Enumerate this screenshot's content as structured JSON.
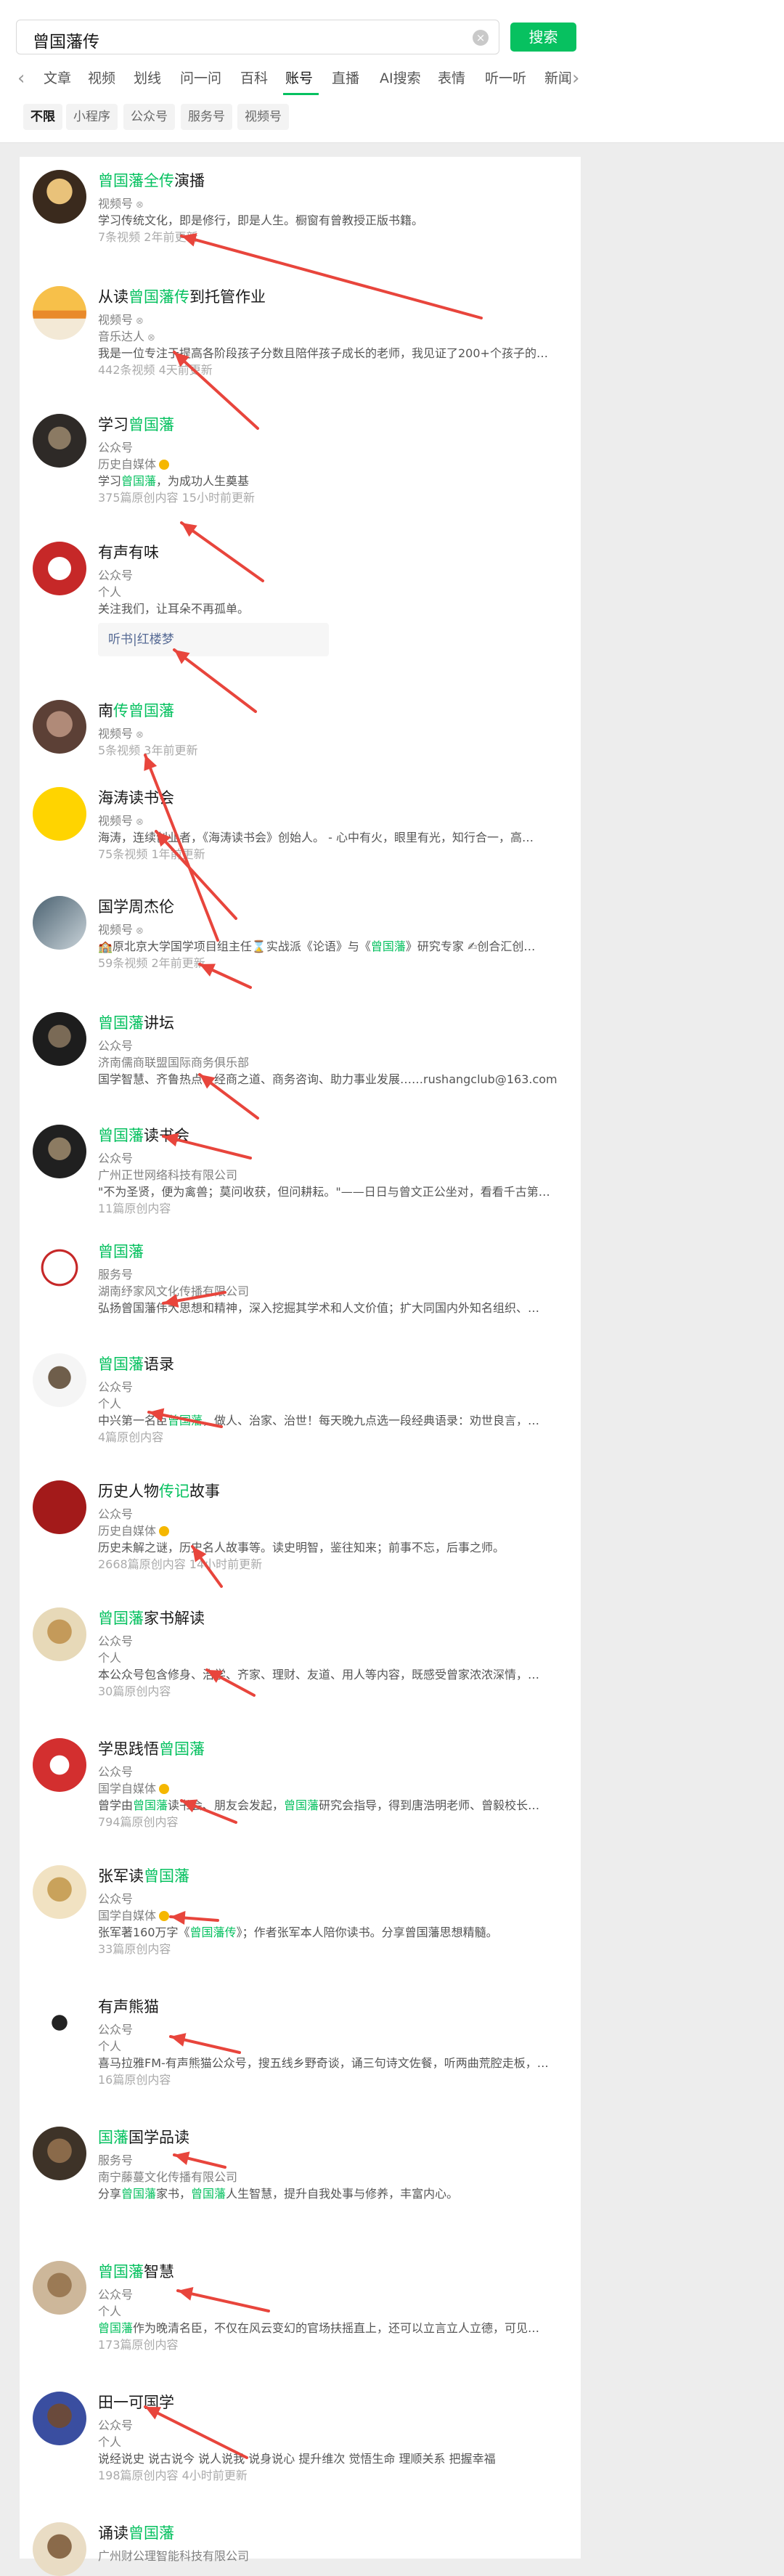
{
  "search": {
    "query": "曾国藩传",
    "clear_icon": "×",
    "button": "搜索"
  },
  "tabs": {
    "left_arrow": "‹",
    "right_arrow": "›",
    "items": [
      "文章",
      "视频",
      "划线",
      "问一问",
      "百科",
      "账号",
      "直播",
      "AI搜索",
      "表情",
      "听一听",
      "新闻"
    ],
    "active": "账号"
  },
  "subtabs": {
    "items": [
      "不限",
      "小程序",
      "公众号",
      "服务号",
      "视频号"
    ],
    "active": "不限"
  },
  "colors": {
    "brand_green": "#07c160",
    "annotation_red": "#e8453c"
  },
  "accounts": [
    {
      "name": [
        [
          "曾国藩全传",
          1
        ],
        [
          "演播",
          0
        ]
      ],
      "lines": [
        {
          "t": "视频号",
          "k": "type",
          "badge": "channel"
        },
        {
          "t": "学习传统文化，即是修行，即是人生。橱窗有曾教授正版书籍。",
          "k": "desc"
        },
        {
          "t": "7条视频  2年前更新",
          "k": "meta"
        }
      ]
    },
    {
      "name": [
        [
          "从读",
          0
        ],
        [
          "曾国藩传",
          1
        ],
        [
          "到托管作业",
          0
        ]
      ],
      "lines": [
        {
          "t": "视频号",
          "k": "type",
          "badge": "channel"
        },
        {
          "t": "音乐达人",
          "k": "type",
          "badge": "channel"
        },
        {
          "t": "我是一位专注于提高各阶段孩子分数且陪伴孩子成长的老师，我见证了200+个孩子的…",
          "k": "desc"
        },
        {
          "t": "442条视频  4天前更新",
          "k": "meta"
        }
      ]
    },
    {
      "name": [
        [
          "学习",
          0
        ],
        [
          "曾国藩",
          1
        ]
      ],
      "lines": [
        {
          "t": "公众号",
          "k": "type"
        },
        {
          "t": "历史自媒体",
          "k": "type",
          "badge": "verified"
        },
        {
          "rich": [
            [
              "学习",
              0
            ],
            [
              "曾国藩",
              1
            ],
            [
              "，为成功人生奠基",
              0
            ]
          ],
          "k": "desc"
        },
        {
          "t": "375篇原创内容  15小时前更新",
          "k": "meta"
        }
      ]
    },
    {
      "name": [
        [
          "有声有味",
          0
        ]
      ],
      "lines": [
        {
          "t": "公众号",
          "k": "type"
        },
        {
          "t": "个人",
          "k": "type"
        },
        {
          "t": "关注我们，让耳朵不再孤单。",
          "k": "desc"
        }
      ],
      "related": "听书|红楼梦"
    },
    {
      "name": [
        [
          "南",
          0
        ],
        [
          "传曾国藩",
          1
        ]
      ],
      "lines": [
        {
          "t": "视频号",
          "k": "type",
          "badge": "channel"
        },
        {
          "t": "5条视频  3年前更新",
          "k": "meta"
        }
      ]
    },
    {
      "name": [
        [
          "海涛读书会",
          0
        ]
      ],
      "lines": [
        {
          "t": "视频号",
          "k": "type",
          "badge": "channel"
        },
        {
          "t": "海涛，连续创业者，《海涛读书会》创始人。 - 心中有火，眼里有光，知行合一，高…",
          "k": "desc"
        },
        {
          "t": "75条视频  1年前更新",
          "k": "meta"
        }
      ]
    },
    {
      "name": [
        [
          "国学周杰伦",
          0
        ]
      ],
      "lines": [
        {
          "t": "视频号",
          "k": "type",
          "badge": "channel"
        },
        {
          "rich": [
            [
              "🏫原北京大学国学项目组主任⌛实战派《论语》与《",
              0
            ],
            [
              "曾国藩",
              1
            ],
            [
              "》研究专家 ✍创合汇创…",
              0
            ]
          ],
          "k": "desc"
        },
        {
          "t": "59条视频  2年前更新",
          "k": "meta"
        }
      ]
    },
    {
      "name": [
        [
          "曾国藩",
          1
        ],
        [
          "讲坛",
          0
        ]
      ],
      "lines": [
        {
          "t": "公众号",
          "k": "type"
        },
        {
          "t": "济南儒商联盟国际商务俱乐部",
          "k": "type"
        },
        {
          "t": "国学智慧、齐鲁热点、经商之道、商务咨询、助力事业发展……rushangclub@163.com",
          "k": "desc"
        }
      ]
    },
    {
      "name": [
        [
          "曾国藩",
          1
        ],
        [
          "读书会",
          0
        ]
      ],
      "lines": [
        {
          "t": "公众号",
          "k": "type"
        },
        {
          "t": "广州正世网络科技有限公司",
          "k": "type"
        },
        {
          "t": "\"不为圣贤，便为禽兽；莫问收获，但问耕耘。\"——日日与曾文正公坐对，看看千古第…",
          "k": "desc"
        },
        {
          "t": "11篇原创内容",
          "k": "meta"
        }
      ]
    },
    {
      "name": [
        [
          "曾国藩",
          1
        ]
      ],
      "lines": [
        {
          "t": "服务号",
          "k": "type"
        },
        {
          "t": "湖南纾家风文化传播有限公司",
          "k": "type"
        },
        {
          "t": "弘扬曾国藩伟大思想和精神，深入挖掘其学术和人文价值；扩大同国内外知名组织、…",
          "k": "desc"
        }
      ]
    },
    {
      "name": [
        [
          "曾国藩",
          1
        ],
        [
          "语录",
          0
        ]
      ],
      "lines": [
        {
          "t": "公众号",
          "k": "type"
        },
        {
          "t": "个人",
          "k": "type"
        },
        {
          "rich": [
            [
              "中兴第一名臣",
              0
            ],
            [
              "曾国藩",
              1
            ],
            [
              "，做人、治家、治世！每天晚九点选一段经典语录：劝世良言，…",
              0
            ]
          ],
          "k": "desc"
        },
        {
          "t": "4篇原创内容",
          "k": "meta"
        }
      ]
    },
    {
      "name": [
        [
          "历史人物",
          0
        ],
        [
          "传记",
          1
        ],
        [
          "故事",
          0
        ]
      ],
      "lines": [
        {
          "t": "公众号",
          "k": "type"
        },
        {
          "t": "历史自媒体",
          "k": "type",
          "badge": "verified"
        },
        {
          "t": "历史未解之谜，历史名人故事等。读史明智，鉴往知来；前事不忘，后事之师。",
          "k": "desc"
        },
        {
          "t": "2668篇原创内容  14小时前更新",
          "k": "meta"
        }
      ]
    },
    {
      "name": [
        [
          "曾国藩",
          1
        ],
        [
          "家书解读",
          0
        ]
      ],
      "lines": [
        {
          "t": "公众号",
          "k": "type"
        },
        {
          "t": "个人",
          "k": "type"
        },
        {
          "t": "本公众号包含修身、治学、齐家、理财、友道、用人等内容，既感受曾家浓浓深情，…",
          "k": "desc"
        },
        {
          "t": "30篇原创内容",
          "k": "meta"
        }
      ]
    },
    {
      "name": [
        [
          "学思践悟",
          0
        ],
        [
          "曾国藩",
          1
        ]
      ],
      "lines": [
        {
          "t": "公众号",
          "k": "type"
        },
        {
          "t": "国学自媒体",
          "k": "type",
          "badge": "verified"
        },
        {
          "rich": [
            [
              "曾学由",
              0
            ],
            [
              "曾国藩",
              1
            ],
            [
              "读书会、朋友会发起，",
              0
            ],
            [
              "曾国藩",
              1
            ],
            [
              "研究会指导，得到唐浩明老师、曾毅校长…",
              0
            ]
          ],
          "k": "desc"
        },
        {
          "t": "794篇原创内容",
          "k": "meta"
        }
      ]
    },
    {
      "name": [
        [
          "张军读",
          0
        ],
        [
          "曾国藩",
          1
        ]
      ],
      "lines": [
        {
          "t": "公众号",
          "k": "type"
        },
        {
          "t": "国学自媒体",
          "k": "type",
          "badge": "verified"
        },
        {
          "rich": [
            [
              "张军著160万字《",
              0
            ],
            [
              "曾国藩传",
              1
            ],
            [
              "》；作者张军本人陪你读书。分享曾国藩思想精髓。",
              0
            ]
          ],
          "k": "desc"
        },
        {
          "t": "33篇原创内容",
          "k": "meta"
        }
      ]
    },
    {
      "name": [
        [
          "有声熊猫",
          0
        ]
      ],
      "lines": [
        {
          "t": "公众号",
          "k": "type"
        },
        {
          "t": "个人",
          "k": "type"
        },
        {
          "t": "喜马拉雅FM-有声熊猫公众号，搜五线乡野奇谈，诵三句诗文佐餐，听两曲荒腔走板，…",
          "k": "desc"
        },
        {
          "t": "16篇原创内容",
          "k": "meta"
        }
      ]
    },
    {
      "name": [
        [
          "国藩",
          1
        ],
        [
          "国学品读",
          0
        ]
      ],
      "lines": [
        {
          "t": "服务号",
          "k": "type"
        },
        {
          "t": "南宁藤蔓文化传播有限公司",
          "k": "type"
        },
        {
          "rich": [
            [
              "分享",
              0
            ],
            [
              "曾国藩",
              1
            ],
            [
              "家书，",
              0
            ],
            [
              "曾国藩",
              1
            ],
            [
              "人生智慧，提升自我处事与修养，丰富内心。",
              0
            ]
          ],
          "k": "desc"
        }
      ]
    },
    {
      "name": [
        [
          "曾国藩",
          1
        ],
        [
          "智慧",
          0
        ]
      ],
      "lines": [
        {
          "t": "公众号",
          "k": "type"
        },
        {
          "t": "个人",
          "k": "type"
        },
        {
          "rich": [
            [
              "曾国藩",
              1
            ],
            [
              "作为晚清名臣，不仅在风云变幻的官场扶摇直上，还可以立言立人立德，可见…",
              0
            ]
          ],
          "k": "desc"
        },
        {
          "t": "173篇原创内容",
          "k": "meta"
        }
      ]
    },
    {
      "name": [
        [
          "田一可国学",
          0
        ]
      ],
      "lines": [
        {
          "t": "公众号",
          "k": "type"
        },
        {
          "t": "个人",
          "k": "type"
        },
        {
          "t": "说经说史 说古说今 说人说我 说身说心 提升维次 觉悟生命 理顺关系 把握幸福",
          "k": "desc"
        },
        {
          "t": "198篇原创内容  4小时前更新",
          "k": "meta"
        }
      ]
    },
    {
      "name": [
        [
          "诵读",
          0
        ],
        [
          "曾国藩",
          1
        ]
      ],
      "lines": [
        {
          "t": "广州财公理智能科技有限公司",
          "k": "type"
        }
      ]
    }
  ]
}
